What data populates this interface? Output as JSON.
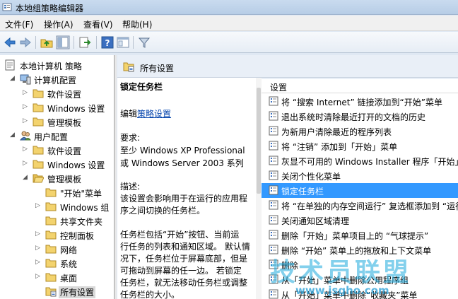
{
  "window": {
    "title": "本地组策略编辑器"
  },
  "menubar": [
    {
      "label": "文件(F)"
    },
    {
      "label": "操作(A)"
    },
    {
      "label": "查看(V)"
    },
    {
      "label": "帮助(H)"
    }
  ],
  "toolbar": {
    "icons": [
      "back-icon",
      "forward-icon",
      "up-folder-icon",
      "show-hide-tree-icon",
      "export-list-icon",
      "help-icon",
      "extended-view-icon",
      "filter-icon"
    ]
  },
  "tree": {
    "items": [
      {
        "label": "本地计算机 策略"
      },
      {
        "label": "计算机配置"
      },
      {
        "label": "软件设置"
      },
      {
        "label": "Windows 设置"
      },
      {
        "label": "管理模板"
      },
      {
        "label": "用户配置"
      },
      {
        "label": "软件设置"
      },
      {
        "label": "Windows 设置"
      },
      {
        "label": "管理模板"
      },
      {
        "label": "\"开始\"菜单"
      },
      {
        "label": "Windows 组"
      },
      {
        "label": "共享文件夹"
      },
      {
        "label": "控制面板"
      },
      {
        "label": "网络"
      },
      {
        "label": "系统"
      },
      {
        "label": "桌面"
      },
      {
        "label": "所有设置"
      }
    ]
  },
  "content": {
    "header_title": "所有设置",
    "description": {
      "title": "锁定任务栏",
      "edit_prefix": "编辑",
      "edit_link": "策略设置",
      "requirements_label": "要求:",
      "requirements_line1": "至少 Windows XP Professional",
      "requirements_line2": "或 Windows Server 2003 系列",
      "desc_label": "描述:",
      "desc_lines": [
        "该设置会影响用于在运行的应用程",
        "序之间切换的任务栏。",
        "",
        "任务栏包括“开始”按钮、当前运",
        "行任务的列表和通知区域。 默认情",
        "况下，任务栏位于屏幕底部，但是",
        "可拖动到屏幕的任一边。 若锁定",
        "任务栏，就无法移动任务栏或调整",
        "任务栏的大小。"
      ]
    },
    "list": {
      "column_header": "设置",
      "rows": [
        {
          "text": "将 “搜索 Internet” 链接添加到“开始”菜单"
        },
        {
          "text": "退出系统时清除最近打开的文档的历史"
        },
        {
          "text": "为新用户清除最近的程序列表"
        },
        {
          "text": "将 “注销” 添加到「开始」菜单"
        },
        {
          "text": "灰显不可用的 Windows Installer 程序「开始」菜单"
        },
        {
          "text": "关闭个性化菜单"
        },
        {
          "text": "锁定任务栏",
          "selected": true
        },
        {
          "text": "将 “在单独的内存空间运行” 复选框添加到 “运行” 对话框"
        },
        {
          "text": "关闭通知区域清理"
        },
        {
          "text": "删除「开始」菜单项目上的 “气球提示”"
        },
        {
          "text": "删除 “开始” 菜单上的拖放和上下文菜单"
        },
        {
          "text": "删除"
        },
        {
          "text": "从「开始」菜单中删除公用程序组"
        },
        {
          "text": "从「开始」菜单中删除“收藏夹”菜单"
        }
      ]
    }
  },
  "watermark": {
    "text": "技术员联盟",
    "url": "www.jsgho.com"
  }
}
